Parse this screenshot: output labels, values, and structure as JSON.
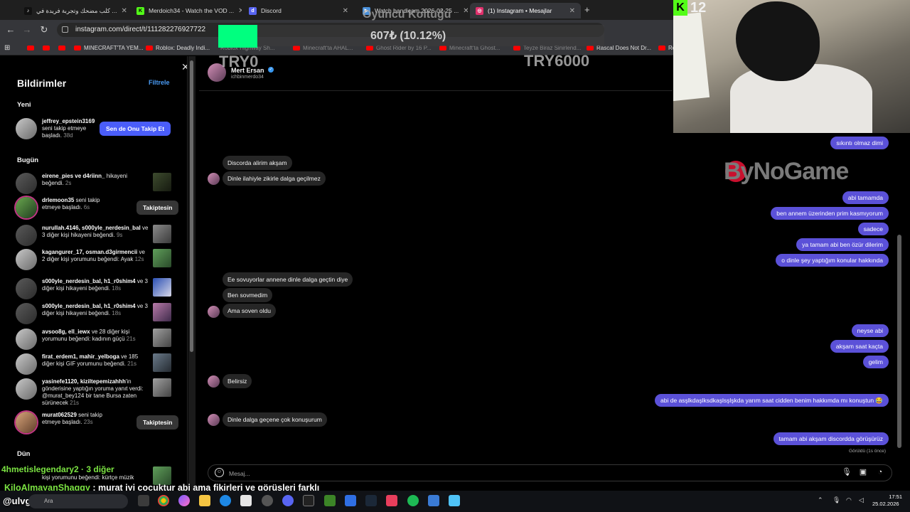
{
  "browser": {
    "tabs": [
      {
        "label": "كلب مضحك وتجربة فريدة في ...",
        "favicon": "tiktok-icon",
        "color": "#000000"
      },
      {
        "label": "Merdoich34 - Watch the VOD ...",
        "favicon": "kick-icon",
        "color": "#53fc18"
      },
      {
        "label": "Discord",
        "favicon": "discord-icon",
        "color": "#5865f2"
      },
      {
        "label": "Watch bandicam 2026-02-25 ...",
        "favicon": "video-icon",
        "color": "#4a90d9"
      },
      {
        "label": "(1) Instagram • Mesajlar",
        "favicon": "instagram-icon",
        "color": "#e1306c"
      }
    ],
    "url": "instagram.com/direct/t/111282276927722",
    "bookmarks": [
      {
        "label": ""
      },
      {
        "label": ""
      },
      {
        "label": "MINECRAFT'TA YEM..."
      },
      {
        "label": "Roblox: Deadly Indi..."
      },
      {
        "label": "Roblox Highway Sh..."
      },
      {
        "label": "Minecraft'ta AHAL..."
      },
      {
        "label": "Ghost Rider by 16 P..."
      },
      {
        "label": "Minecraft'ta Ghost..."
      },
      {
        "label": "Teyze Biraz Sinirlend..."
      },
      {
        "label": "Rascal Does Not Dr..."
      },
      {
        "label": "Ro"
      }
    ]
  },
  "stream_overlay": {
    "title": "Oyuncu Koltuğu",
    "amount": "607₺ (10.12%)",
    "min": "TRY0",
    "max": "TRY6000",
    "progress_percent": 10.12,
    "viewers": "12",
    "brand": "ByNoGame"
  },
  "notifications": {
    "title": "Bildirimler",
    "filter": "Filtrele",
    "section_new": "Yeni",
    "section_today": "Bugün",
    "section_older": "Dün",
    "new_items": [
      {
        "user": "jeffrey_epstein3169",
        "text": " seni takip etmeye başladı.",
        "time": " 38d",
        "button": "Sen de Onu Takip Et"
      }
    ],
    "today_items": [
      {
        "user": "eirene_pies ve d4riinn_",
        "text": " hikayeni beğendi.",
        "time": " 2s"
      },
      {
        "user": "drlemoon35",
        "text": " seni takip etmeye başladı.",
        "time": " 6s",
        "button": "Takiptesin"
      },
      {
        "user": "nurullah.4146, s000yle_nerdesin_bal",
        "text": " ve 3 diğer kişi hikayeni beğendi.",
        "time": " 9s"
      },
      {
        "user": "kagangurer_17, osman.d3girmencii",
        "text": " ve 2 diğer kişi yorumunu beğendi: Ayak",
        "time": " 12s"
      },
      {
        "user": "s000yle_nerdesin_bal, h1_r0shim4",
        "text": " ve 3 diğer kişi hikayeni beğendi.",
        "time": " 18s"
      },
      {
        "user": "s000yle_nerdesin_bal, h1_r0shim4",
        "text": " ve 3 diğer kişi hikayeni beğendi.",
        "time": " 18s"
      },
      {
        "user": "avsoo8g, ell_iewx",
        "text": " ve 28 diğer kişi yorumunu beğendi: kadının güçü",
        "time": " 21s"
      },
      {
        "user": "firat_erdem1, mahir_yelboga",
        "text": " ve 185 diğer kişi GIF yorumunu beğendi.",
        "time": " 21s"
      },
      {
        "user": "yasinefe1120, kiziltepemizahhh",
        "text": "'in gönderisine yaptığın yoruma yanıt verdi: @murat_bey124 bir tane Bursa zaten sürünecek",
        "time": " 21s"
      },
      {
        "user": "murat062529",
        "text": " seni takip etmeye başladı.",
        "time": " 23s",
        "button": "Takiptesin"
      }
    ],
    "older_item": {
      "text": "kişi yorumunu beğendi: kürtçe müzik"
    }
  },
  "chat": {
    "name": "Mert Ersan",
    "handle": "ichbinmerdo34",
    "incoming": [
      "Discorda alirim akşam",
      "Dinle ilahiyle zikirle dalga geçilmez",
      "Ee sovuyorlar annene dinle dalga geçtin diye",
      "Ben sovmedim",
      "Ama soven oldu",
      "Belirsiz",
      "Dinle dalga geçene çok konuşurum"
    ],
    "outgoing": [
      "sıkıntı olmaz dimi",
      "abi tamamda",
      "ben annem üzerinden prim  kasmıyorum",
      "sadece",
      "ya tamam abi ben özür dilerim",
      "o dinle şey yaptığım konular hakkında",
      "neyse abi",
      "akşam saat kaçta",
      "gelim",
      "abi de asşlkdaşlksdkaşlsşlşkda yarım saat cidden benim hakkımda mı konuştun 😂",
      "tamam abi akşam  discordda görüşürüz"
    ],
    "seen": "Görüldü (1s önce)",
    "composer_placeholder": "Mesaj..."
  },
  "stream_chat": {
    "line1": "4hmetislegendary2 · 3 diğer",
    "line2_user": "KiloAlmayanShaggy",
    "line2_text": " : murat iyi çocuktur abi ama fikirleri ve görüşleri farklı",
    "line3": "@ulvgus"
  },
  "taskbar": {
    "search": "Ara",
    "time": "17:51",
    "date": "25.02.2026"
  }
}
